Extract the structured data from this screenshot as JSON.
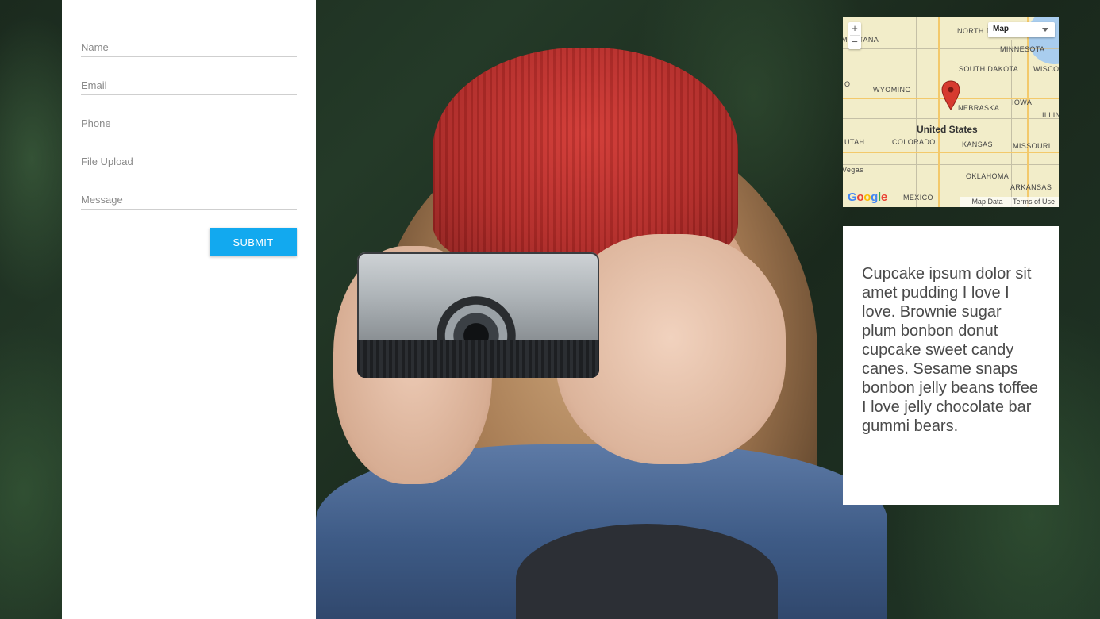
{
  "form": {
    "fields": [
      {
        "label": "Name"
      },
      {
        "label": "Email"
      },
      {
        "label": "Phone"
      },
      {
        "label": "File Upload"
      },
      {
        "label": "Message"
      }
    ],
    "submit_label": "SUBMIT"
  },
  "map": {
    "zoom_in": "+",
    "zoom_out": "−",
    "map_type": "Map",
    "labels": {
      "north_dakota": "NORTH DAKOTA",
      "montana": "MONTANA",
      "minnesota": "MINNESOTA",
      "south_dakota": "SOUTH DAKOTA",
      "wyoming": "WYOMING",
      "wisconsin": "WISCO",
      "iowa": "IOWA",
      "nebraska": "NEBRASKA",
      "illinois": "ILLIN",
      "utah": "UTAH",
      "colorado": "COLORADO",
      "kansas": "KANSAS",
      "missouri": "MISSOURI",
      "united_states": "United States",
      "las_vegas": "Vegas",
      "oklahoma": "OKLAHOMA",
      "arkansas": "ARKANSAS",
      "new_mexico": "MEXICO",
      "left_edge": "O"
    },
    "logo": "Google",
    "footer": {
      "map_data": "Map Data",
      "terms": "Terms of Use"
    },
    "colors": {
      "land": "#f2edc9",
      "water": "#a9cdee",
      "pin": "#d63a2f"
    }
  },
  "card": {
    "text": "Cupcake ipsum dolor sit amet pudding I love I love. Brownie sugar plum bonbon donut cupcake sweet candy canes. Sesame snaps bonbon jelly beans toffee I love jelly chocolate bar gummi bears."
  },
  "theme": {
    "accent": "#12a9ef"
  }
}
